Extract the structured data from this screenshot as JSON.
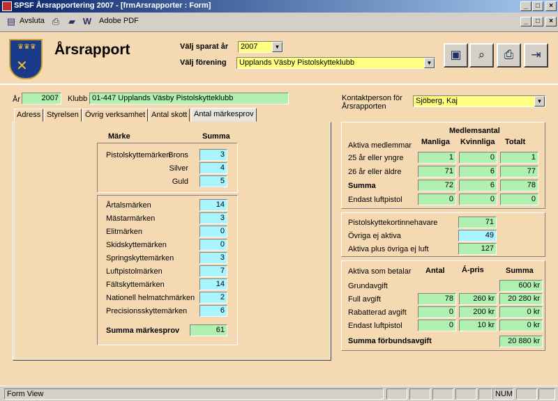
{
  "window": {
    "title": "SPSF Årsrapportering 2007 - [frmArsrapporter : Form]"
  },
  "toolbar": {
    "close_label": "Avsluta",
    "pdf_label": "Adobe PDF"
  },
  "header": {
    "title": "Årsrapport",
    "year_label": "Välj sparat år",
    "year_value": "2007",
    "club_label": "Välj förening",
    "club_value": "Upplands Väsby Pistolskytteklubb"
  },
  "info": {
    "ar_label": "År",
    "ar_value": "2007",
    "klubb_label": "Klubb",
    "klubb_value": "01-447 Upplands Väsby Pistolskytteklubb",
    "contact_label": "Kontaktperson för Årsrapporten",
    "contact_value": "Sjöberg, Kaj"
  },
  "tabs": [
    "Adress",
    "Styrelsen",
    "Övrig verksamhet",
    "Antal skott",
    "Antal märkesprov"
  ],
  "marken": {
    "col_marke": "Märke",
    "col_summa": "Summa",
    "pistol_label": "Pistolskyttemärken",
    "pistol": [
      {
        "label": "Brons",
        "value": "3"
      },
      {
        "label": "Silver",
        "value": "4"
      },
      {
        "label": "Guld",
        "value": "5"
      }
    ],
    "others": [
      {
        "label": "Årtalsmärken",
        "value": "14"
      },
      {
        "label": "Mästarmärken",
        "value": "3"
      },
      {
        "label": "Elitmärken",
        "value": "0"
      },
      {
        "label": "Skidskyttemärken",
        "value": "0"
      },
      {
        "label": "Springskyttemärken",
        "value": "3"
      },
      {
        "label": "Luftpistolmärken",
        "value": "7"
      },
      {
        "label": "Fältskyttemärken",
        "value": "14"
      },
      {
        "label": "Nationell helmatchmärken",
        "value": "2"
      },
      {
        "label": "Precisionsskyttemärken",
        "value": "6"
      }
    ],
    "total_label": "Summa märkesprov",
    "total_value": "61"
  },
  "members": {
    "heading": "Medlemsantal",
    "aktiva": "Aktiva medlemmar",
    "cols": [
      "Manliga",
      "Kvinnliga",
      "Totalt"
    ],
    "rows": [
      {
        "label": "25 år eller yngre",
        "v": [
          "1",
          "0",
          "1"
        ]
      },
      {
        "label": "26 år eller äldre",
        "v": [
          "71",
          "6",
          "77"
        ]
      },
      {
        "label": "Summa",
        "v": [
          "72",
          "6",
          "78"
        ]
      },
      {
        "label": "Endast luftpistol",
        "v": [
          "0",
          "0",
          "0"
        ]
      }
    ]
  },
  "other": {
    "rows": [
      {
        "label": "Pistolskyttekortinnehavare",
        "value": "71"
      },
      {
        "label": "Övriga ej aktiva",
        "value": "49"
      },
      {
        "label": "Aktiva plus övriga ej luft",
        "value": "127"
      }
    ]
  },
  "fees": {
    "head_label": "Aktiva som betalar",
    "cols": [
      "Antal",
      "Á-pris",
      "Summa"
    ],
    "grund_label": "Grundavgift",
    "grund_sum": "600 kr",
    "rows": [
      {
        "label": "Full avgift",
        "v": [
          "78",
          "260 kr",
          "20 280 kr"
        ]
      },
      {
        "label": "Rabatterad avgift",
        "v": [
          "0",
          "200 kr",
          "0 kr"
        ]
      },
      {
        "label": "Endast luftpistol",
        "v": [
          "0",
          "10 kr",
          "0 kr"
        ]
      }
    ],
    "total_label": "Summa förbundsavgift",
    "total_value": "20 880 kr"
  },
  "status": {
    "left": "Form View",
    "num": "NUM"
  }
}
